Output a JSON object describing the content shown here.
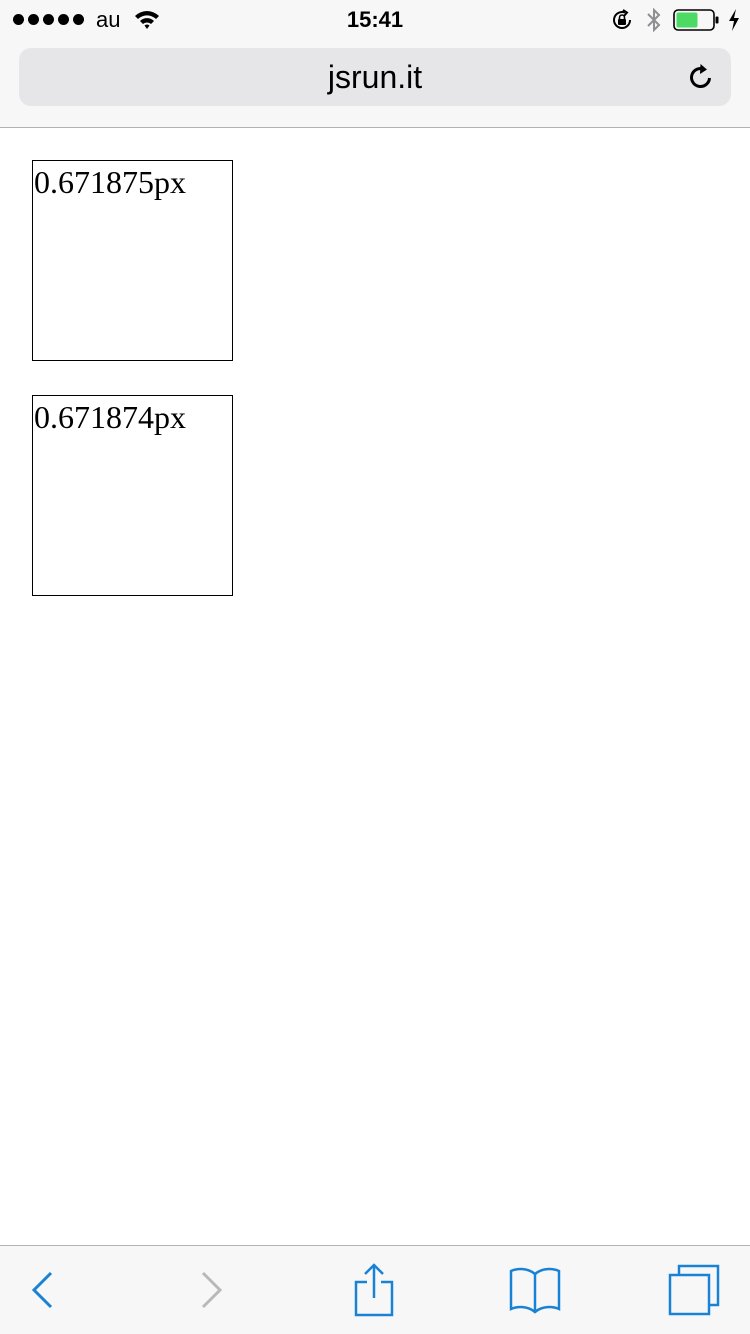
{
  "status_bar": {
    "carrier": "au",
    "time": "15:41",
    "battery_color": "#4cd964"
  },
  "browser": {
    "url": "jsrun.it",
    "accent_color": "#1a82d4",
    "disabled_color": "#b9b9b9"
  },
  "boxes": [
    {
      "label": "0.671875px"
    },
    {
      "label": "0.671874px"
    }
  ],
  "toolbar": {
    "icons": [
      "back-icon",
      "forward-icon",
      "share-icon",
      "bookmarks-icon",
      "tabs-icon"
    ]
  }
}
